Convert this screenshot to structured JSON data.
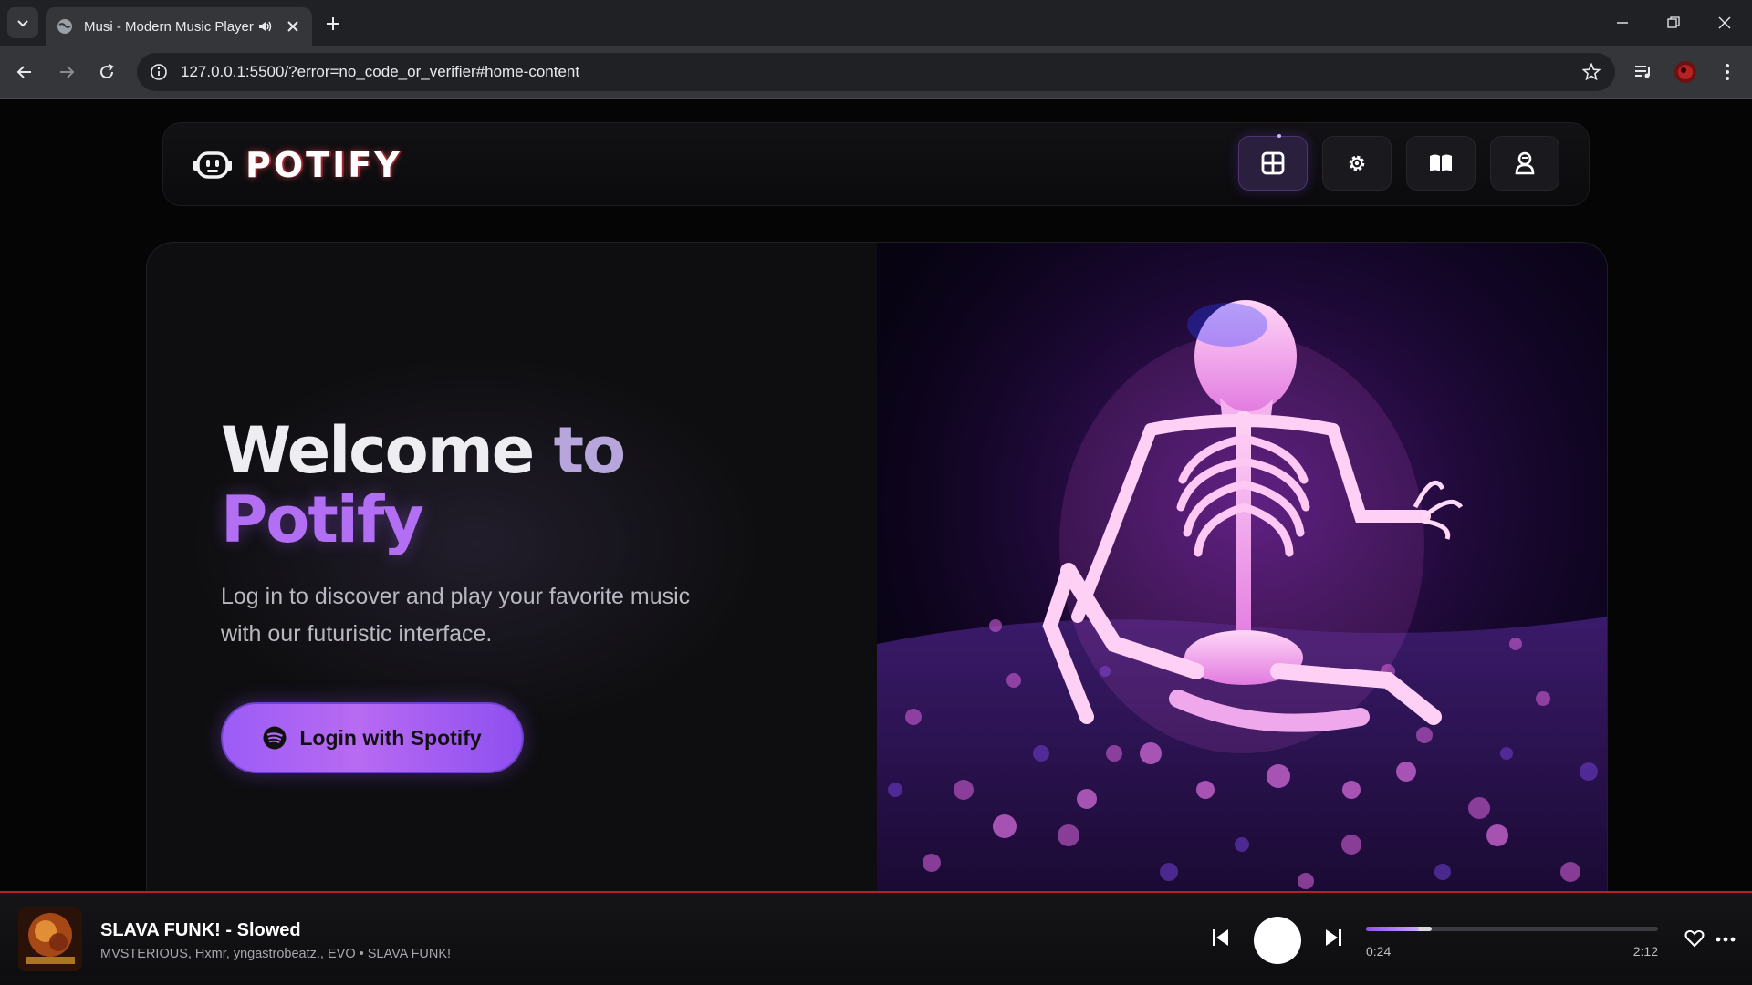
{
  "browser": {
    "tab_title": "Musi - Modern Music Player",
    "url": "127.0.0.1:5500/?error=no_code_or_verifier#home-content"
  },
  "app": {
    "logo_text": "POTIFY",
    "nav": [
      {
        "name": "home",
        "icon": "grid-icon",
        "active": true
      },
      {
        "name": "settings",
        "icon": "gear-icon",
        "active": false
      },
      {
        "name": "library",
        "icon": "book-icon",
        "active": false
      },
      {
        "name": "profile",
        "icon": "user-icon",
        "active": false
      }
    ]
  },
  "hero": {
    "title_line1_a": "Welcome ",
    "title_line1_b": "to",
    "title_line2": "Potify",
    "subtitle": "Log in to discover and play your favorite music with our futuristic interface.",
    "login_label": "Login with Spotify",
    "image": "glowing-skeleton-in-flower-field"
  },
  "player": {
    "title": "SLAVA FUNK! - Slowed",
    "artists": "MVSTERIOUS, Hxmr, yngastrobeatz., EVO • SLAVA FUNK!",
    "current_time": "0:24",
    "total_time": "2:12",
    "progress": 0.18,
    "buffered": 0.2
  },
  "colors": {
    "accent": "#9b5cf6",
    "player_border": "#b3202c"
  }
}
